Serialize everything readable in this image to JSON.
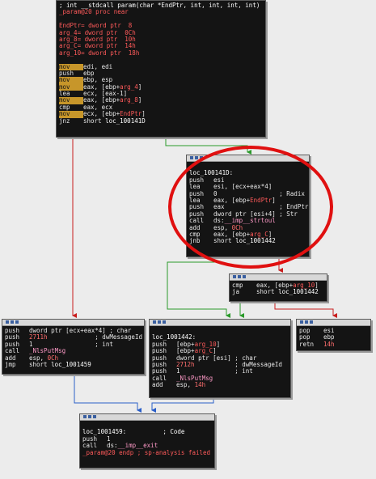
{
  "nodes": {
    "n0": {
      "lines": [
        {
          "mn": "",
          "op": "; int __stdcall param(char *EndPtr, int, int, int, int)",
          "kind": "comment"
        },
        {
          "mn": "",
          "op": "_param@20 proc near",
          "kind": "sym"
        },
        {
          "mn": "",
          "op": "",
          "kind": "blank"
        },
        {
          "mn": "",
          "op": "EndPtr= dword ptr  8",
          "kind": "sym"
        },
        {
          "mn": "",
          "op": "arg_4= dword ptr  0Ch",
          "kind": "sym"
        },
        {
          "mn": "",
          "op": "arg_8= dword ptr  10h",
          "kind": "sym"
        },
        {
          "mn": "",
          "op": "arg_C= dword ptr  14h",
          "kind": "sym"
        },
        {
          "mn": "",
          "op": "arg_10= dword ptr  18h",
          "kind": "sym"
        },
        {
          "mn": "",
          "op": "",
          "kind": "blank"
        },
        {
          "mn": "mov",
          "op": "edi, edi",
          "hl": true
        },
        {
          "mn": "push",
          "op": "ebp"
        },
        {
          "mn": "mov",
          "op": "ebp, esp",
          "hl": true
        },
        {
          "mn": "mov",
          "op": "eax, [ebp+arg_4]",
          "hl": true
        },
        {
          "mn": "lea",
          "op": "ecx, [eax-1]"
        },
        {
          "mn": "mov",
          "op": "eax, [ebp+arg_8]",
          "hl": true
        },
        {
          "mn": "cmp",
          "op": "eax, ecx"
        },
        {
          "mn": "mov",
          "op": "ecx, [ebp+EndPtr]",
          "hl": true
        },
        {
          "mn": "jnz",
          "op": "short loc_100141D"
        }
      ]
    },
    "n1": {
      "lines": [
        {
          "mn": "",
          "op": "",
          "kind": "blank"
        },
        {
          "mn": "",
          "op": "loc_100141D:",
          "kind": "label"
        },
        {
          "mn": "push",
          "op": "esi"
        },
        {
          "mn": "lea",
          "op": "esi, [ecx+eax*4]"
        },
        {
          "mn": "push",
          "op": "0                 ; Radix"
        },
        {
          "mn": "lea",
          "op": "eax, [ebp+EndPtr]"
        },
        {
          "mn": "push",
          "op": "eax               ; EndPtr"
        },
        {
          "mn": "push",
          "op": "dword ptr [esi+4] ; Str"
        },
        {
          "mn": "call",
          "op": "ds:__imp__strtoul"
        },
        {
          "mn": "add",
          "op": "esp, 0Ch"
        },
        {
          "mn": "cmp",
          "op": "eax, [ebp+arg_C]"
        },
        {
          "mn": "jnb",
          "op": "short loc_1001442"
        }
      ]
    },
    "n2": {
      "lines": [
        {
          "mn": "cmp",
          "op": "eax, [ebp+arg_10]"
        },
        {
          "mn": "ja",
          "op": "short loc_1001442"
        }
      ]
    },
    "n3": {
      "lines": [
        {
          "mn": "push",
          "op": "dword ptr [ecx+eax*4] ; char"
        },
        {
          "mn": "push",
          "op": "2711h             ; dwMessageId"
        },
        {
          "mn": "push",
          "op": "1                 ; int"
        },
        {
          "mn": "call",
          "op": "_NlsPutMsg"
        },
        {
          "mn": "add",
          "op": "esp, 0Ch"
        },
        {
          "mn": "jmp",
          "op": "short loc_1001459"
        }
      ]
    },
    "n4": {
      "lines": [
        {
          "mn": "",
          "op": "",
          "kind": "blank"
        },
        {
          "mn": "",
          "op": "loc_1001442:",
          "kind": "label"
        },
        {
          "mn": "push",
          "op": "[ebp+arg_10]"
        },
        {
          "mn": "push",
          "op": "[ebp+arg_C]"
        },
        {
          "mn": "push",
          "op": "dword ptr [esi] ; char"
        },
        {
          "mn": "push",
          "op": "2712h           ; dwMessageId"
        },
        {
          "mn": "push",
          "op": "1               ; int"
        },
        {
          "mn": "call",
          "op": "_NlsPutMsg"
        },
        {
          "mn": "add",
          "op": "esp, 14h"
        }
      ]
    },
    "n5": {
      "lines": [
        {
          "mn": "pop",
          "op": "esi"
        },
        {
          "mn": "pop",
          "op": "ebp"
        },
        {
          "mn": "retn",
          "op": "14h"
        }
      ]
    },
    "n6": {
      "lines": [
        {
          "mn": "",
          "op": "",
          "kind": "blank"
        },
        {
          "mn": "",
          "op": "loc_1001459:          ; Code",
          "kind": "label"
        },
        {
          "mn": "push",
          "op": "1"
        },
        {
          "mn": "call",
          "op": "ds:__imp__exit"
        },
        {
          "mn": "",
          "op": "_param@20 endp ; sp-analysis failed",
          "kind": "sym"
        }
      ]
    }
  },
  "colors": {
    "edge_true": "#2a9a2a",
    "edge_false": "#c81e1e",
    "edge_uncond": "#2a5fc8",
    "annotation_circle": "#e01010",
    "highlight_mnemonic": "#c7962a"
  }
}
